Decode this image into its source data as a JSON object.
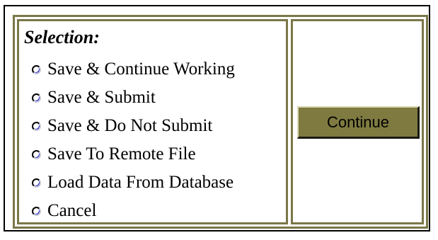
{
  "form": {
    "title": "Selection:",
    "options": [
      {
        "label": "Save & Continue Working",
        "selected": false
      },
      {
        "label": "Save & Submit",
        "selected": false
      },
      {
        "label": "Save & Do Not Submit",
        "selected": false
      },
      {
        "label": "Save To Remote File",
        "selected": false
      },
      {
        "label": "Load Data From Database",
        "selected": false
      },
      {
        "label": "Cancel",
        "selected": false
      }
    ],
    "continue_label": "Continue"
  },
  "colors": {
    "frame_border": "#7a7748",
    "button_face": "#7f7a40",
    "radio_accent": "#3333cc"
  }
}
